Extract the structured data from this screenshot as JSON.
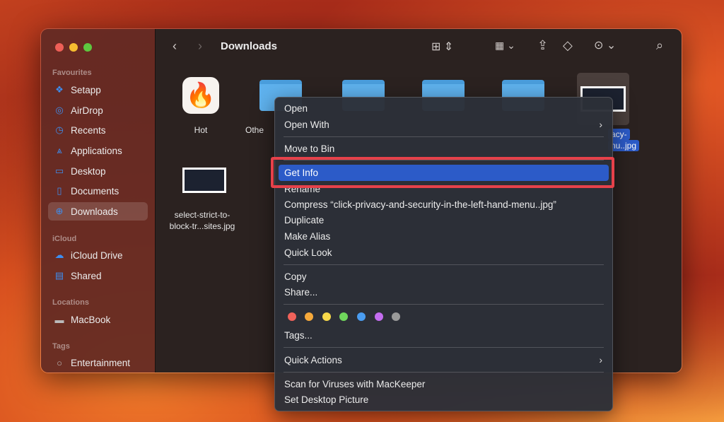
{
  "window": {
    "title": "Downloads"
  },
  "sidebar": {
    "sections": [
      {
        "label": "Favourites"
      },
      {
        "label": "iCloud"
      },
      {
        "label": "Locations"
      },
      {
        "label": "Tags"
      }
    ],
    "items": [
      {
        "label": "Setapp",
        "icon": "setapp-icon"
      },
      {
        "label": "AirDrop",
        "icon": "airdrop-icon"
      },
      {
        "label": "Recents",
        "icon": "clock-icon"
      },
      {
        "label": "Applications",
        "icon": "applications-icon"
      },
      {
        "label": "Desktop",
        "icon": "desktop-icon"
      },
      {
        "label": "Documents",
        "icon": "document-icon"
      },
      {
        "label": "Downloads",
        "icon": "download-icon"
      },
      {
        "label": "iCloud Drive",
        "icon": "cloud-icon"
      },
      {
        "label": "Shared",
        "icon": "shared-folder-icon"
      },
      {
        "label": "MacBook",
        "icon": "drive-icon"
      },
      {
        "label": "Entertainment",
        "icon": "tag-circle-icon"
      }
    ]
  },
  "files": [
    {
      "name": "Hot"
    },
    {
      "name": "Othe"
    },
    {
      "name": "select-strict-to-block-tr...sites.jpg"
    },
    {
      "name": "acy-"
    },
    {
      "name": "nu..jpg"
    }
  ],
  "menu": {
    "items": [
      "Open",
      "Open With",
      "Move to Bin",
      "Get Info",
      "Rename",
      "Compress “click-privacy-and-security-in-the-left-hand-menu..jpg”",
      "Duplicate",
      "Make Alias",
      "Quick Look",
      "Copy",
      "Share...",
      "Tags...",
      "Quick Actions",
      "Scan for Viruses with MacKeeper",
      "Set Desktop Picture"
    ]
  },
  "tag_colors": [
    "#f0625a",
    "#f6a93b",
    "#f7d84a",
    "#6fd65c",
    "#4a9cf0",
    "#c46df0",
    "#9a9a9a"
  ],
  "colors": {
    "accent": "#2c5bc8",
    "highlight_box": "#e6414a"
  }
}
